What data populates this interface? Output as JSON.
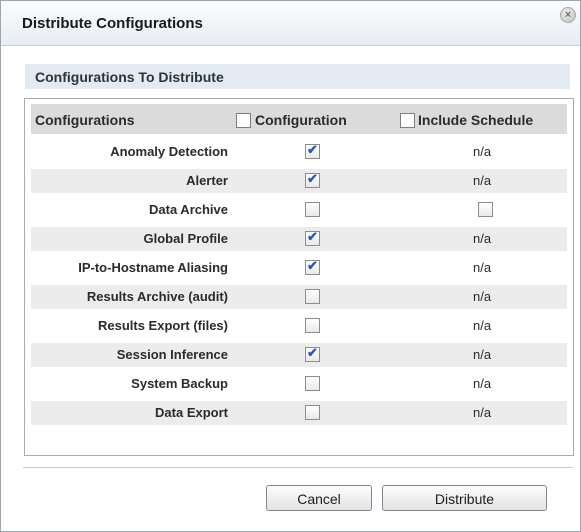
{
  "dialog": {
    "title": "Distribute Configurations",
    "close_icon": "close-icon"
  },
  "section": {
    "title": "Configurations To Distribute"
  },
  "table": {
    "headers": {
      "configurations": "Configurations",
      "configuration": "Configuration",
      "include_schedule": "Include Schedule"
    },
    "header_checkboxes": {
      "configuration_checked": false,
      "include_schedule_checked": false
    },
    "rows": [
      {
        "label": "Anomaly Detection",
        "configuration_checked": true,
        "schedule": "n/a"
      },
      {
        "label": "Alerter",
        "configuration_checked": true,
        "schedule": "n/a"
      },
      {
        "label": "Data Archive",
        "configuration_checked": false,
        "schedule_checkbox": true,
        "schedule_checked": false
      },
      {
        "label": "Global Profile",
        "configuration_checked": true,
        "schedule": "n/a"
      },
      {
        "label": "IP-to-Hostname Aliasing",
        "configuration_checked": true,
        "schedule": "n/a"
      },
      {
        "label": "Results Archive (audit)",
        "configuration_checked": false,
        "schedule": "n/a"
      },
      {
        "label": "Results Export (files)",
        "configuration_checked": false,
        "schedule": "n/a"
      },
      {
        "label": "Session Inference",
        "configuration_checked": true,
        "schedule": "n/a"
      },
      {
        "label": "System Backup",
        "configuration_checked": false,
        "schedule": "n/a"
      },
      {
        "label": "Data Export",
        "configuration_checked": false,
        "schedule": "n/a"
      }
    ]
  },
  "buttons": {
    "cancel": "Cancel",
    "distribute": "Distribute"
  },
  "colors": {
    "check_mark": "#2e57b8",
    "section_header_bg": "#e3eaf2",
    "table_header_bg": "#dbdbdb",
    "alt_row_bg": "#ececec"
  }
}
